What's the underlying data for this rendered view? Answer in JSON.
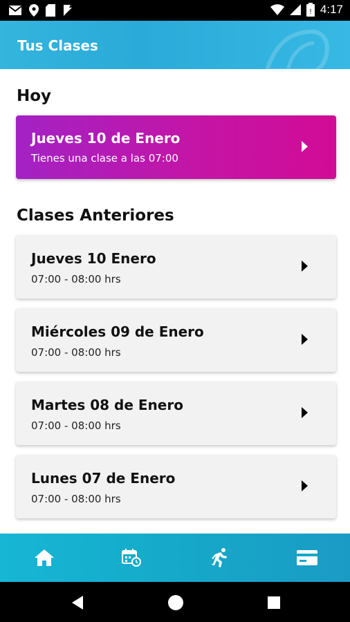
{
  "status_bar": {
    "time": "4:17",
    "icons": [
      "mail-icon",
      "location-icon",
      "sim-icon",
      "notification-icon",
      "wifi-icon",
      "signal-icon",
      "battery-icon"
    ]
  },
  "app_bar": {
    "title": "Tus Clases"
  },
  "today": {
    "section_title": "Hoy",
    "card": {
      "day": "Jueves 10 de Enero",
      "subtitle": "Tienes una clase a las 07:00"
    }
  },
  "previous": {
    "section_title": "Clases Anteriores",
    "items": [
      {
        "day": "Jueves 10 Enero",
        "time": "07:00 - 08:00 hrs"
      },
      {
        "day": "Miércoles 09 de Enero",
        "time": "07:00 - 08:00 hrs"
      },
      {
        "day": "Martes 08 de Enero",
        "time": "07:00 - 08:00 hrs"
      },
      {
        "day": "Lunes 07 de Enero",
        "time": "07:00 - 08:00 hrs"
      }
    ]
  },
  "bottom_nav": {
    "items": [
      "home-icon",
      "calendar-clock-icon",
      "running-icon",
      "card-icon"
    ]
  },
  "colors": {
    "app_bar": "#2aaad8",
    "today_card_start": "#a322c4",
    "today_card_end": "#d10c96",
    "bottom_nav": "#16a9c9",
    "card_bg": "#f2f2f2"
  }
}
